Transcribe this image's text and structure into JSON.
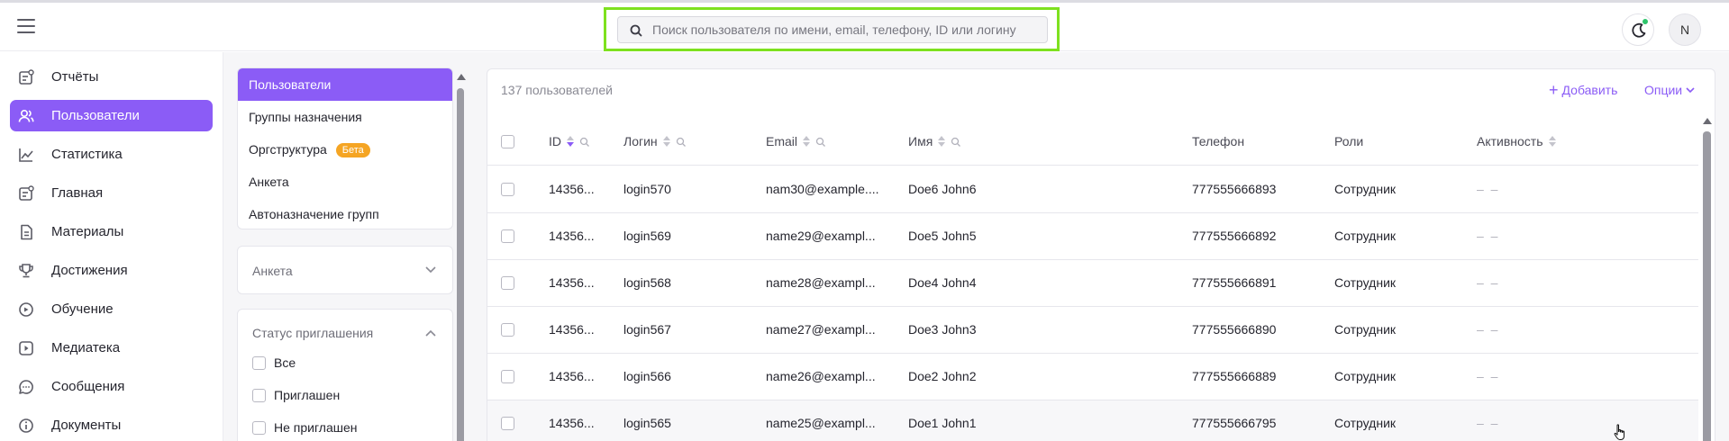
{
  "header": {
    "search_placeholder": "Поиск пользователя по имени, email, телефону, ID или логину",
    "avatar_initial": "N"
  },
  "nav": {
    "items": [
      {
        "label": "Отчёты",
        "icon": "report-icon"
      },
      {
        "label": "Пользователи",
        "icon": "users-icon",
        "active": true
      },
      {
        "label": "Статистика",
        "icon": "chart-line-icon"
      },
      {
        "label": "Главная",
        "icon": "home-icon"
      },
      {
        "label": "Материалы",
        "icon": "document-icon"
      },
      {
        "label": "Достижения",
        "icon": "trophy-icon"
      },
      {
        "label": "Обучение",
        "icon": "learning-icon"
      },
      {
        "label": "Медиатека",
        "icon": "media-icon"
      },
      {
        "label": "Сообщения",
        "icon": "chat-icon"
      },
      {
        "label": "Документы",
        "icon": "info-icon"
      }
    ]
  },
  "groups": {
    "items": [
      {
        "label": "Пользователи",
        "active": true
      },
      {
        "label": "Группы назначения"
      },
      {
        "label": "Оргструктура",
        "badge": "Бета"
      },
      {
        "label": "Анкета"
      },
      {
        "label": "Автоназначение групп"
      }
    ]
  },
  "filters": {
    "anketa_label": "Анкета",
    "status_title": "Статус приглашения",
    "status_options": [
      "Все",
      "Приглашен",
      "Не приглашен"
    ]
  },
  "table": {
    "count_label": "137 пользователей",
    "add_label": "Добавить",
    "options_label": "Опции",
    "columns": [
      "ID",
      "Логин",
      "Email",
      "Имя",
      "Телефон",
      "Роли",
      "Активность"
    ],
    "rows": [
      {
        "id": "14356...",
        "login": "login570",
        "email": "nam30@example....",
        "name": "Doe6 John6",
        "phone": "777555666893",
        "role": "Сотрудник",
        "activity": "– –"
      },
      {
        "id": "14356...",
        "login": "login569",
        "email": "name29@exampl...",
        "name": "Doe5 John5",
        "phone": "777555666892",
        "role": "Сотрудник",
        "activity": "– –"
      },
      {
        "id": "14356...",
        "login": "login568",
        "email": "name28@exampl...",
        "name": "Doe4 John4",
        "phone": "777555666891",
        "role": "Сотрудник",
        "activity": "– –"
      },
      {
        "id": "14356...",
        "login": "login567",
        "email": "name27@exampl...",
        "name": "Doe3 John3",
        "phone": "777555666890",
        "role": "Сотрудник",
        "activity": "– –"
      },
      {
        "id": "14356...",
        "login": "login566",
        "email": "name26@exampl...",
        "name": "Doe2 John2",
        "phone": "777555666889",
        "role": "Сотрудник",
        "activity": "– –"
      },
      {
        "id": "14356...",
        "login": "login565",
        "email": "name25@exampl...",
        "name": "Doe1 John1",
        "phone": "777555666795",
        "role": "Сотрудник",
        "activity": "– –"
      }
    ]
  },
  "colors": {
    "accent": "#8b5cf6",
    "highlight": "#7ee11f",
    "beta_badge": "#f5a524",
    "status_dot": "#2ec46b"
  }
}
